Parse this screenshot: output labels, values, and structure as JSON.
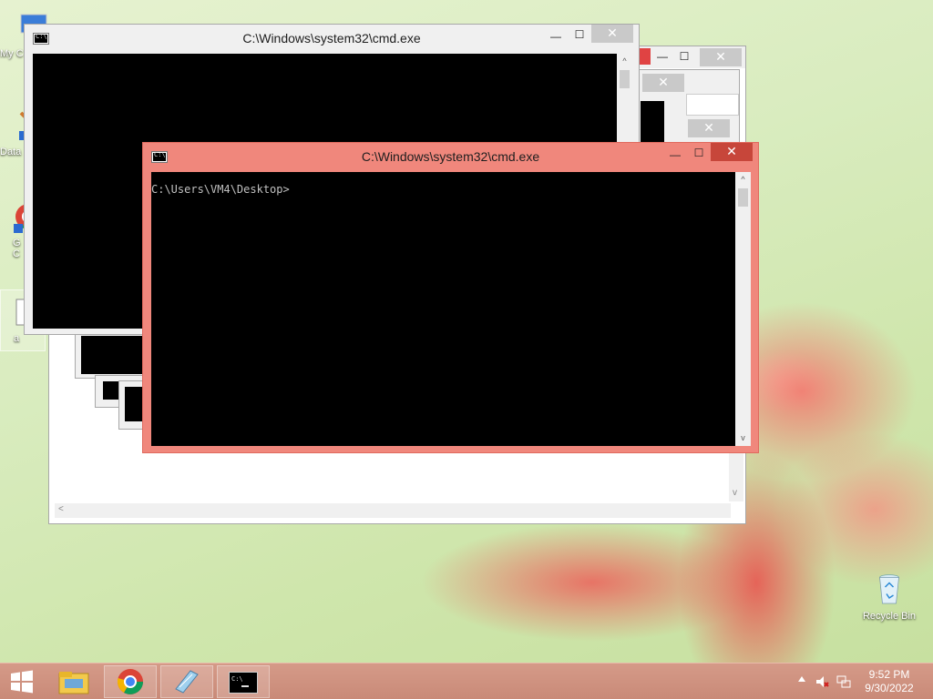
{
  "desktop": {
    "icons": [
      {
        "label": "My C",
        "icon": "computer-icon"
      },
      {
        "label": "Data",
        "icon": "data-shortcut-icon"
      },
      {
        "label": "G\nC",
        "icon": "chrome-shortcut-icon"
      },
      {
        "label": "a",
        "icon": "file-icon"
      }
    ],
    "recycle_bin": {
      "label": "Recycle Bin",
      "icon": "recycle-bin-icon"
    }
  },
  "windows": {
    "back_cmd": {
      "title": "C:\\Windows\\system32\\cmd.exe"
    },
    "front_cmd": {
      "title": "C:\\Windows\\system32\\cmd.exe",
      "prompt": "C:\\Users\\VM4\\Desktop>"
    },
    "controls": {
      "minimize": "—",
      "maximize": "☐",
      "close": "✕"
    }
  },
  "taskbar": {
    "start_icon": "windows-start-icon",
    "apps": [
      {
        "name": "File Explorer",
        "icon": "folder-icon"
      },
      {
        "name": "Google Chrome",
        "icon": "chrome-icon"
      },
      {
        "name": "Notepad",
        "icon": "notepad-icon"
      },
      {
        "name": "Command Prompt",
        "icon": "cmd-icon"
      }
    ],
    "tray": {
      "time": "9:52 PM",
      "date": "9/30/2022",
      "icons": [
        "show-hidden-icons",
        "volume-muted-icon",
        "network-icon"
      ]
    }
  },
  "colors": {
    "active_title": "#f0877c",
    "close_red": "#c7463a",
    "taskbar": "#cf9280"
  }
}
